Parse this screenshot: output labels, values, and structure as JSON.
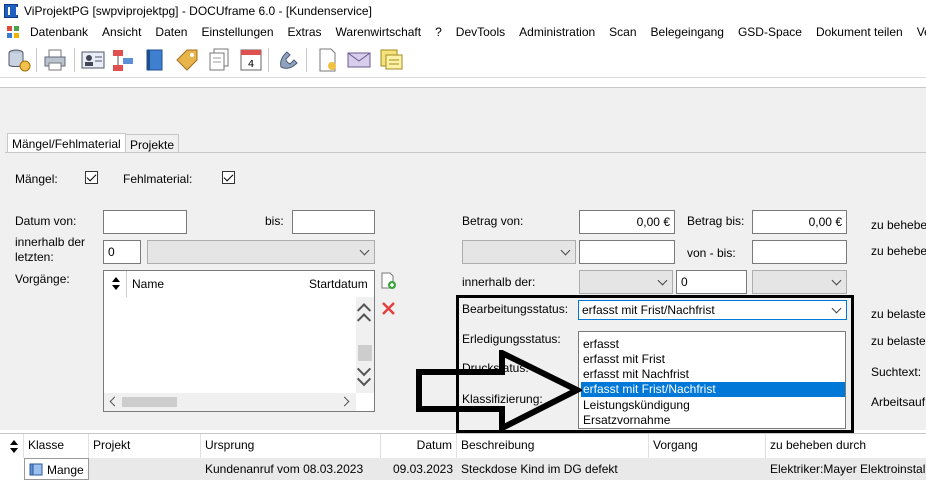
{
  "window": {
    "title": "ViProjektPG [swpviprojektpg] - DOCUframe 6.0 - [Kundenservice]"
  },
  "menu": [
    "Datenbank",
    "Ansicht",
    "Daten",
    "Einstellungen",
    "Extras",
    "Warenwirtschaft",
    "?",
    "DevTools",
    "Administration",
    "Scan",
    "Belegeingang",
    "GSD-Space",
    "Dokument teilen",
    "Vertr"
  ],
  "toolbar_icons": [
    "database-icon",
    "printer-icon",
    "address-card-icon",
    "org-chart-icon",
    "book-icon",
    "tag-icon",
    "documents-icon",
    "calendar-icon",
    "phone-icon",
    "document-icon",
    "envelope-icon",
    "notes-icon"
  ],
  "calendar_day": "4",
  "tabs": {
    "maengel": "Mängel/Fehlmaterial",
    "projekte": "Projekte"
  },
  "filters": {
    "maengel_label": "Mängel:",
    "fehlmaterial_label": "Fehlmaterial:",
    "datum_von_label": "Datum von:",
    "bis_label": "bis:",
    "innerhalb_letzten_label": "innerhalb der letzten:",
    "innerhalb_value": "0",
    "vorgaenge_label": "Vorgänge:",
    "vorgaenge_col_name": "Name",
    "vorgaenge_col_start": "Startdatum",
    "betrag_von_label": "Betrag von:",
    "betrag_von_value": "0,00 €",
    "betrag_bis_label": "Betrag bis:",
    "betrag_bis_value": "0,00 €",
    "von_bis_label": "von - bis:",
    "innerhalb_der_label": "innerhalb der:",
    "innerhalb_der_value": "0",
    "bearbeitungsstatus_label": "Bearbeitungsstatus:",
    "bearbeitungsstatus_value": "erfasst mit Frist/Nachfrist",
    "erledigungsstatus_label": "Erledigungsstatus:",
    "druckstatus_label": "Druckstatus:",
    "klassifizierung_label": "Klassifizierung:",
    "zu_beheben_1": "zu behebe",
    "zu_beheben_2": "zu behebe",
    "zu_belasten_1": "zu belaster",
    "zu_belasten_2": "zu belaster",
    "suchtext_label": "Suchtext:",
    "arbeitsauftrag_label": "Arbeitsauf"
  },
  "dropdown_options": [
    "erfasst",
    "erfasst mit Frist",
    "erfasst mit Nachfrist",
    "erfasst mit Frist/Nachfrist",
    "Leistungskündigung",
    "Ersatzvornahme"
  ],
  "dropdown_selected_index": 3,
  "results": {
    "columns": [
      "Klasse",
      "Projekt",
      "Ursprung",
      "Datum",
      "Beschreibung",
      "Vorgang",
      "zu beheben durch"
    ],
    "rows": [
      {
        "klasse": "Mange",
        "projekt": "",
        "ursprung": "Kundenanruf vom 08.03.2023",
        "datum": "09.03.2023",
        "beschreibung": "Steckdose Kind im DG defekt",
        "vorgang": "",
        "zu_beheben_durch": "Elektriker:Mayer Elektroinstalla"
      }
    ]
  },
  "colors": {
    "selection": "#0078d7",
    "highlight_box": "#000000",
    "delete": "#e04040"
  }
}
